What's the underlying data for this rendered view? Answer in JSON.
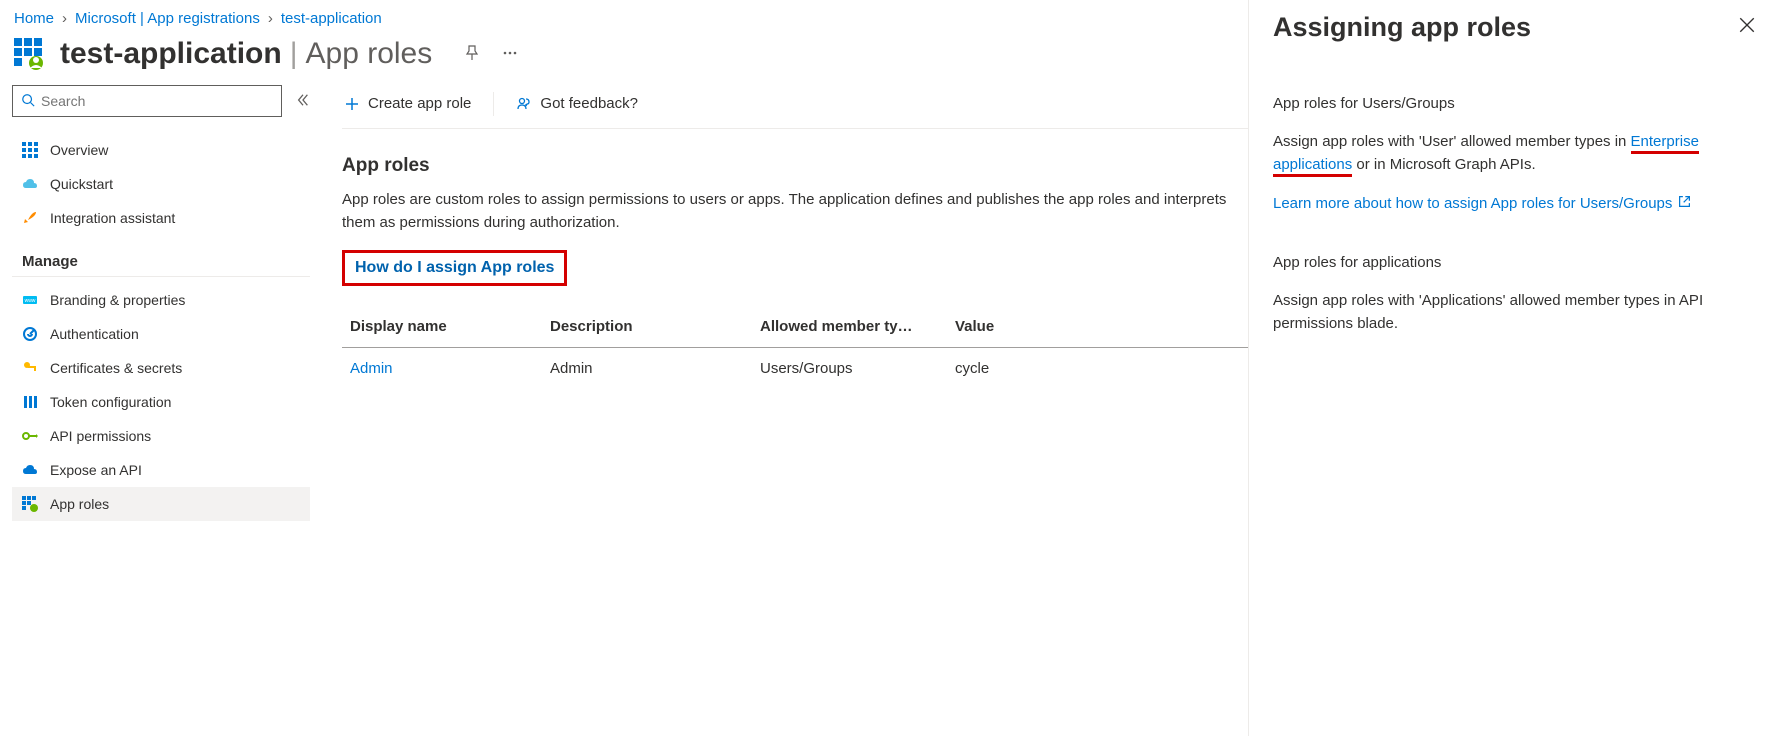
{
  "breadcrumb": {
    "items": [
      {
        "label": "Home"
      },
      {
        "label": "Microsoft | App registrations"
      },
      {
        "label": "test-application"
      }
    ]
  },
  "header": {
    "app_name": "test-application",
    "subtitle": "App roles"
  },
  "search": {
    "placeholder": "Search"
  },
  "nav": {
    "top": [
      {
        "label": "Overview",
        "icon": "grid"
      },
      {
        "label": "Quickstart",
        "icon": "cloud"
      },
      {
        "label": "Integration assistant",
        "icon": "rocket"
      }
    ],
    "manage_title": "Manage",
    "manage": [
      {
        "label": "Branding & properties",
        "icon": "branding"
      },
      {
        "label": "Authentication",
        "icon": "auth"
      },
      {
        "label": "Certificates & secrets",
        "icon": "key"
      },
      {
        "label": "Token configuration",
        "icon": "token"
      },
      {
        "label": "API permissions",
        "icon": "apiperm"
      },
      {
        "label": "Expose an API",
        "icon": "expose"
      },
      {
        "label": "App roles",
        "icon": "approles",
        "active": true
      }
    ]
  },
  "toolbar": {
    "create_label": "Create app role",
    "feedback_label": "Got feedback?"
  },
  "section": {
    "heading": "App roles",
    "description": "App roles are custom roles to assign permissions to users or apps. The application defines and publishes the app roles and interprets them as permissions during authorization.",
    "howlink": "How do I assign App roles"
  },
  "table": {
    "headers": {
      "display_name": "Display name",
      "description": "Description",
      "allowed": "Allowed member ty…",
      "value": "Value"
    },
    "rows": [
      {
        "display_name": "Admin",
        "description": "Admin",
        "allowed": "Users/Groups",
        "value": "cycle"
      }
    ]
  },
  "panel": {
    "title": "Assigning app roles",
    "section1": {
      "subtitle": "App roles for Users/Groups",
      "text_before": "Assign app roles with 'User' allowed member types in ",
      "link_text": "Enterprise applications",
      "text_after": " or in Microsoft Graph APIs.",
      "learn_more": "Learn more about how to assign App roles for Users/Groups"
    },
    "section2": {
      "subtitle": "App roles for applications",
      "text": "Assign app roles with 'Applications' allowed member types in API permissions blade."
    }
  }
}
